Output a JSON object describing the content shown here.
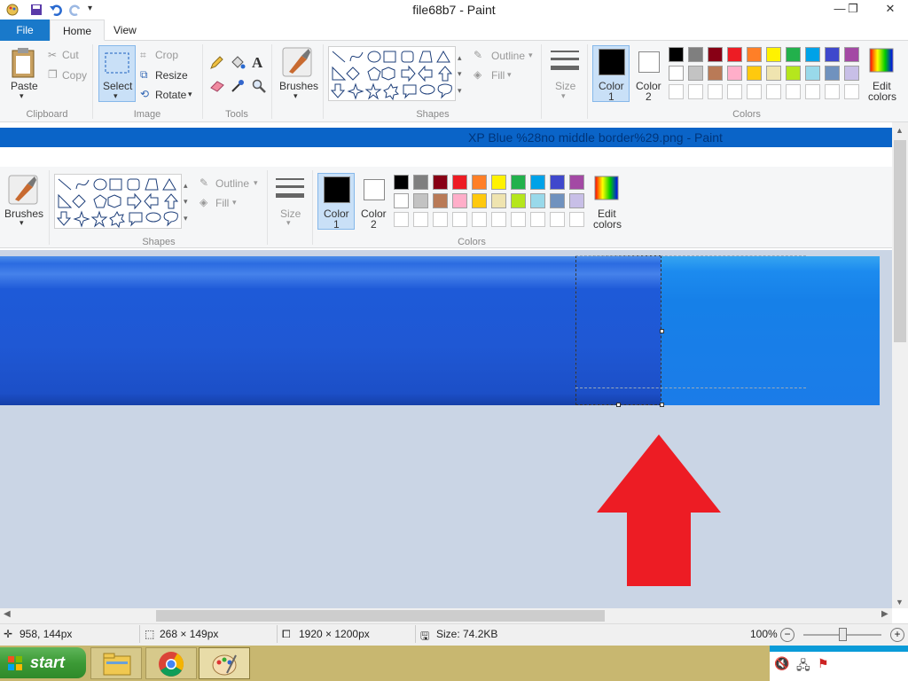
{
  "window": {
    "title": "file68b7 - Paint",
    "minimize": "—",
    "maximize": "❐",
    "close": "✕"
  },
  "tabs": {
    "file": "File",
    "home": "Home",
    "view": "View"
  },
  "clipboard": {
    "paste": "Paste",
    "cut": "Cut",
    "copy": "Copy",
    "group": "Clipboard"
  },
  "image": {
    "select": "Select",
    "crop": "Crop",
    "resize": "Resize",
    "rotate": "Rotate",
    "group": "Image"
  },
  "tools": {
    "group": "Tools"
  },
  "brushes": {
    "label": "Brushes"
  },
  "shapes": {
    "outline": "Outline",
    "fill": "Fill",
    "group": "Shapes"
  },
  "size": {
    "label": "Size"
  },
  "colors": {
    "color1": "Color",
    "color1_num": "1",
    "color2": "Color",
    "color2_num": "2",
    "edit": "Edit",
    "edit2": "colors",
    "group": "Colors",
    "row1": [
      "#000000",
      "#7f7f7f",
      "#880015",
      "#ed1c24",
      "#ff7f27",
      "#fff200",
      "#22b14c",
      "#00a2e8",
      "#3f48cc",
      "#a349a4"
    ],
    "row2": [
      "#ffffff",
      "#c3c3c3",
      "#b97a57",
      "#ffaec9",
      "#ffc90e",
      "#efe4b0",
      "#b5e61d",
      "#99d9ea",
      "#7092be",
      "#c8bfe7"
    ]
  },
  "window2": {
    "title": "XP Blue %28no middle border%29.png - Paint"
  },
  "status": {
    "cursor": "958, 144px",
    "selection": "268 × 149px",
    "image_size": "1920 × 1200px",
    "file_size": "Size: 74.2KB",
    "zoom": "100%",
    "minus": "−",
    "plus": "+"
  },
  "taskbar": {
    "start": "start"
  }
}
